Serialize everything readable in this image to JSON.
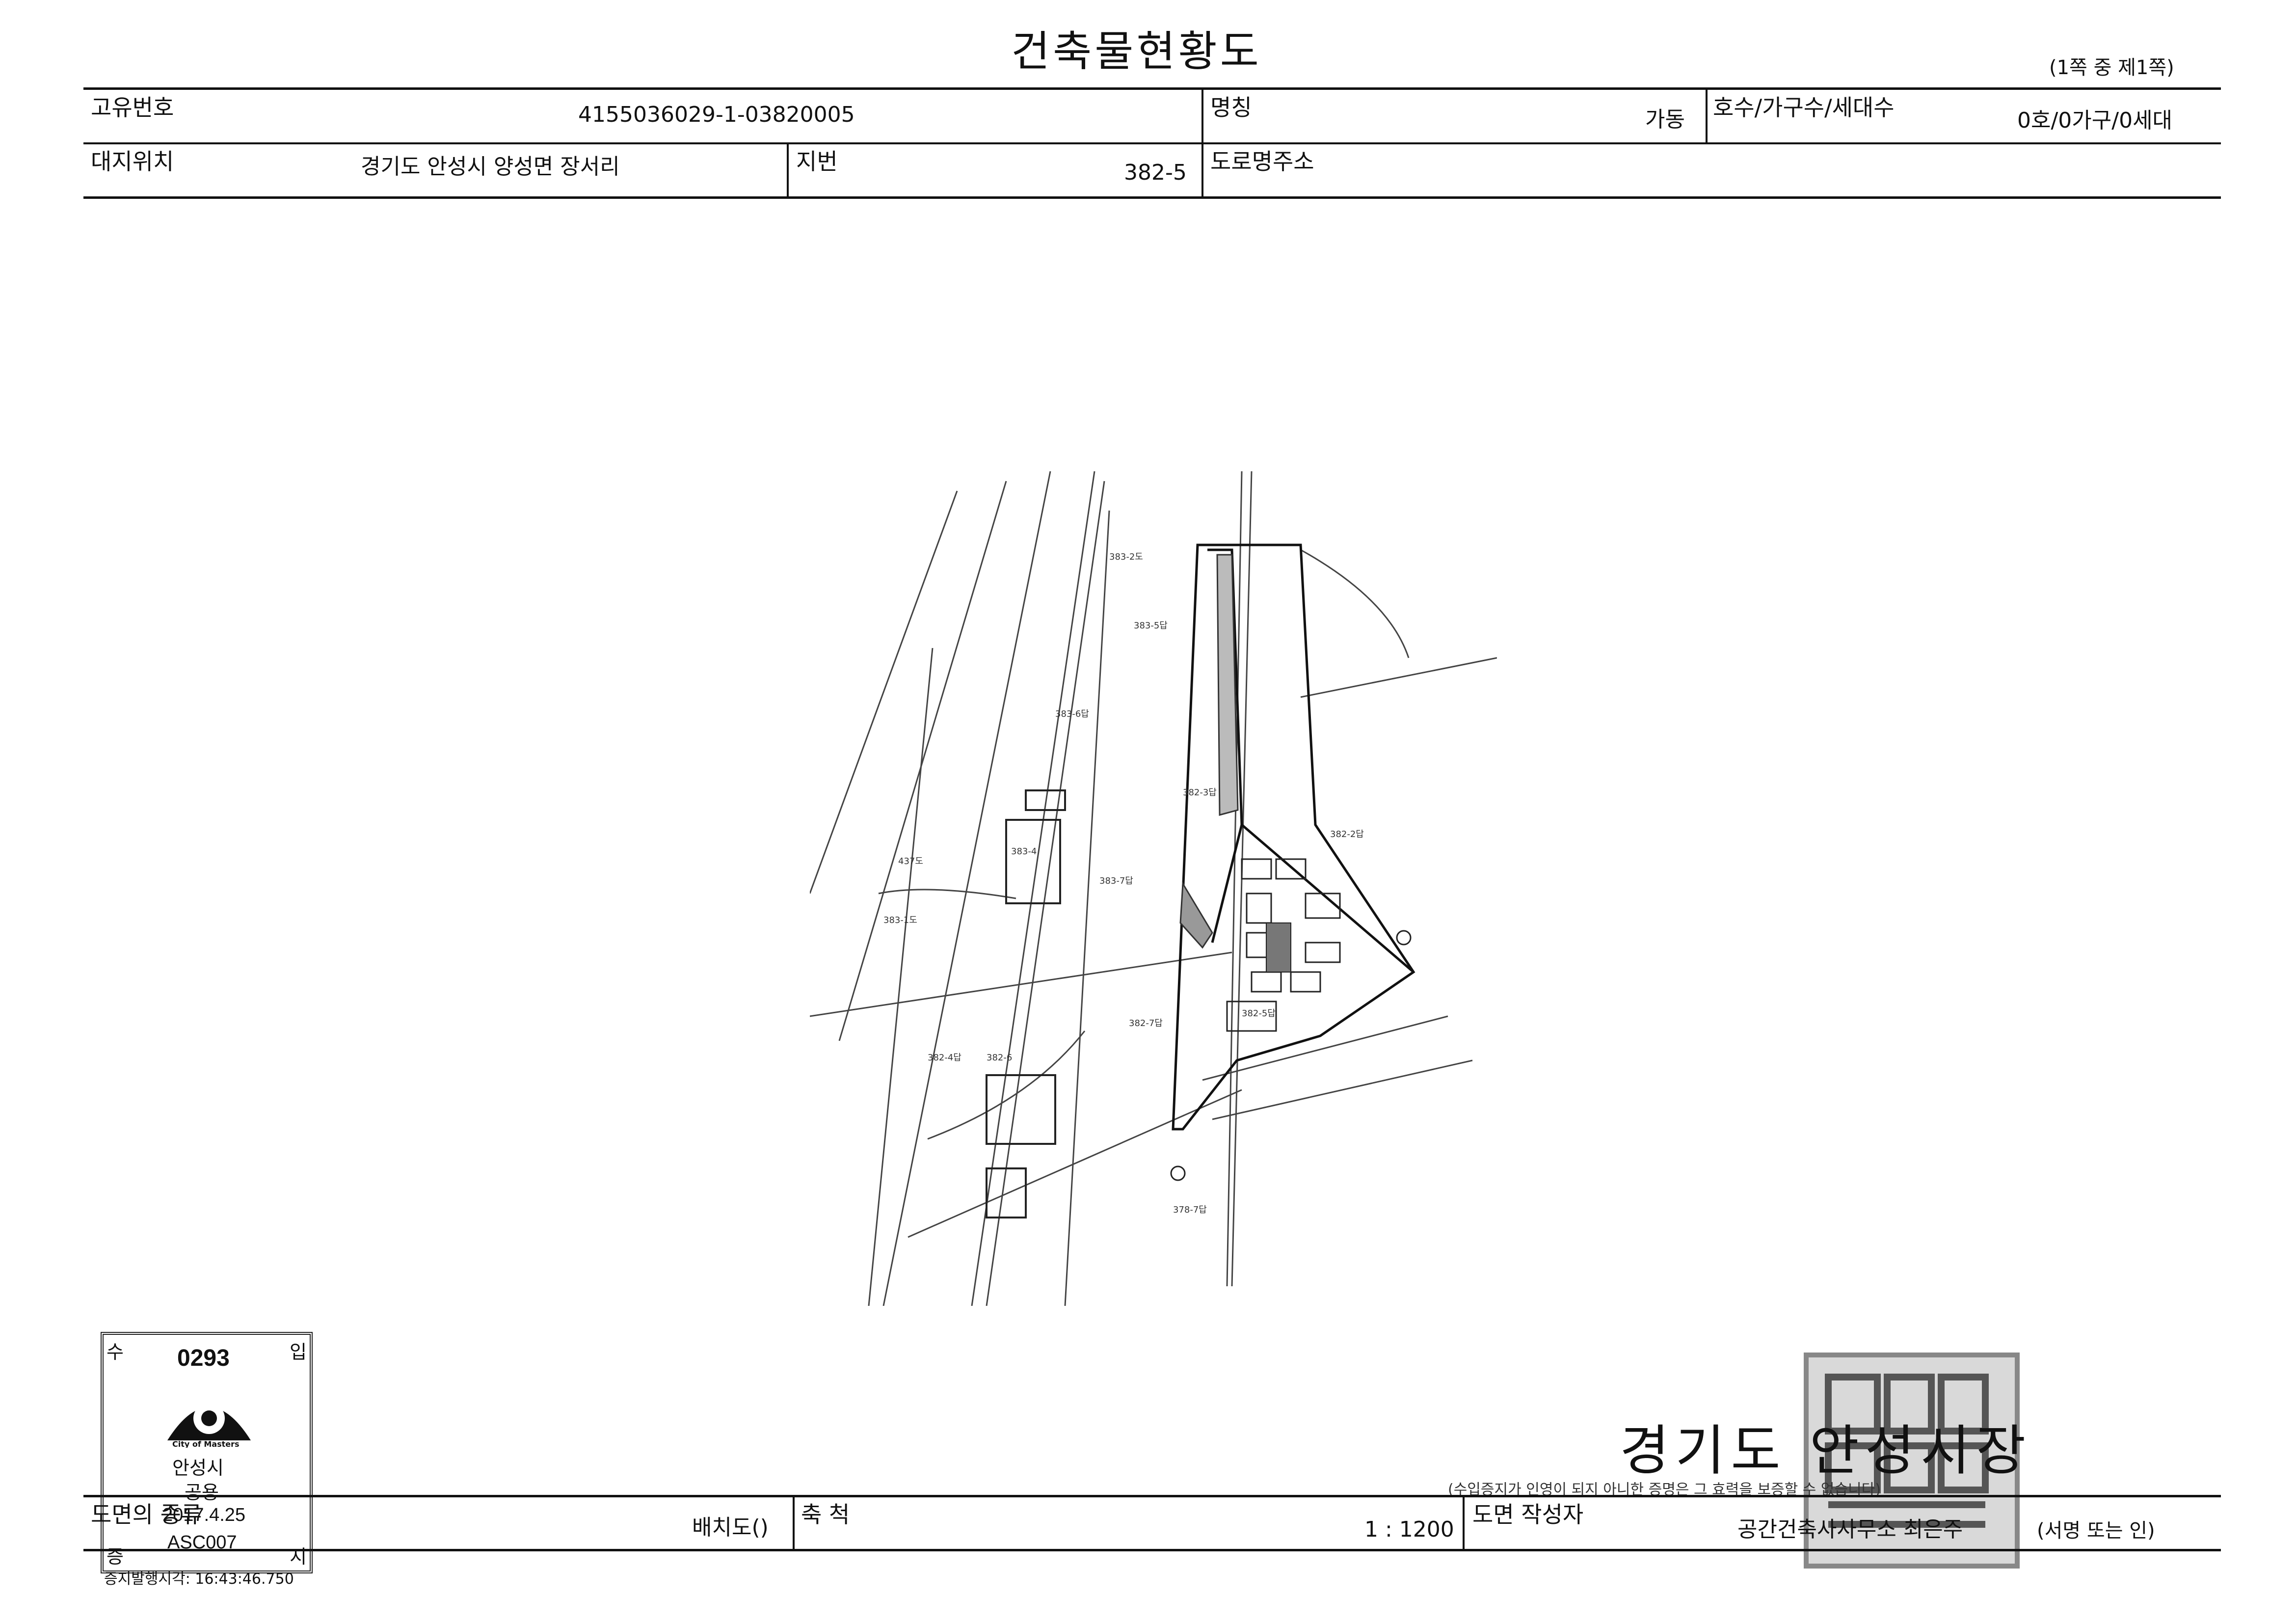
{
  "title": "건축물현황도",
  "page_info": "(1쪽 중 제1쪽)",
  "header": {
    "unique_no_label": "고유번호",
    "unique_no_value": "4155036029-1-03820005",
    "name_label": "명칭",
    "name_value": "가동",
    "units_label": "호수/가구수/세대수",
    "units_value": "0호/0가구/0세대",
    "site_label": "대지위치",
    "site_value": "경기도 안성시 양성면 장서리",
    "lot_label": "지번",
    "lot_value": "382-5",
    "road_label": "도로명주소",
    "road_value": ""
  },
  "drawing": {
    "parcel_labels": [
      "383-2도",
      "383-5답",
      "383-6답",
      "382-3답",
      "382-2답",
      "383-4",
      "383-7답",
      "382-7답",
      "382-4답",
      "382-6",
      "382-5답",
      "378-7답",
      "437도",
      "383-1도"
    ]
  },
  "footer": {
    "drawing_name_label": "도면의 종류",
    "drawing_name_value": "배치도()",
    "scale_label": "축 척",
    "scale_value": "1 : 1200",
    "author_label": "도면 작성자",
    "author_value": "공간건축사사무소 최은주",
    "sign_hint": "(서명 또는 인)",
    "issuer": "경기도 안성시장",
    "disclaimer": "(수입증지가 인영이 되지 아니한 증명은 그 효력을 보증할 수 없습니다)",
    "issued_time": "증지발행시각: 16:43:46.750"
  },
  "stamp": {
    "number": "0293",
    "corner_tl": "수",
    "corner_tr": "입",
    "corner_bl": "증",
    "corner_br": "지",
    "logo_caption": "City of Masters",
    "city": "안성시",
    "usage": "공용",
    "date": "2017.4.25",
    "code": "ASC007"
  }
}
